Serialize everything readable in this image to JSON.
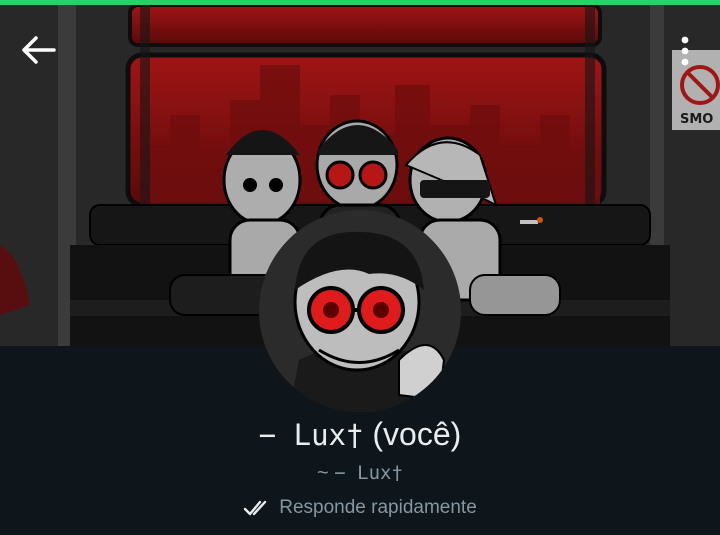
{
  "colors": {
    "accent": "#25d366",
    "background": "#0f161b",
    "primary_text": "#e9edef",
    "secondary_text": "#8696a0",
    "glasses_red": "#e01b1b"
  },
  "header": {
    "back_icon": "arrow-left-icon",
    "menu_icon": "more-vertical-icon",
    "cover_image_text": "SMO"
  },
  "profile": {
    "name_prefix": "− Lux†",
    "name_suffix": " (você)",
    "subtitle_prefix": "~ ",
    "subtitle_name": "− Lux†",
    "status_icon": "double-check-icon",
    "status_text": "Responde rapidamente"
  }
}
